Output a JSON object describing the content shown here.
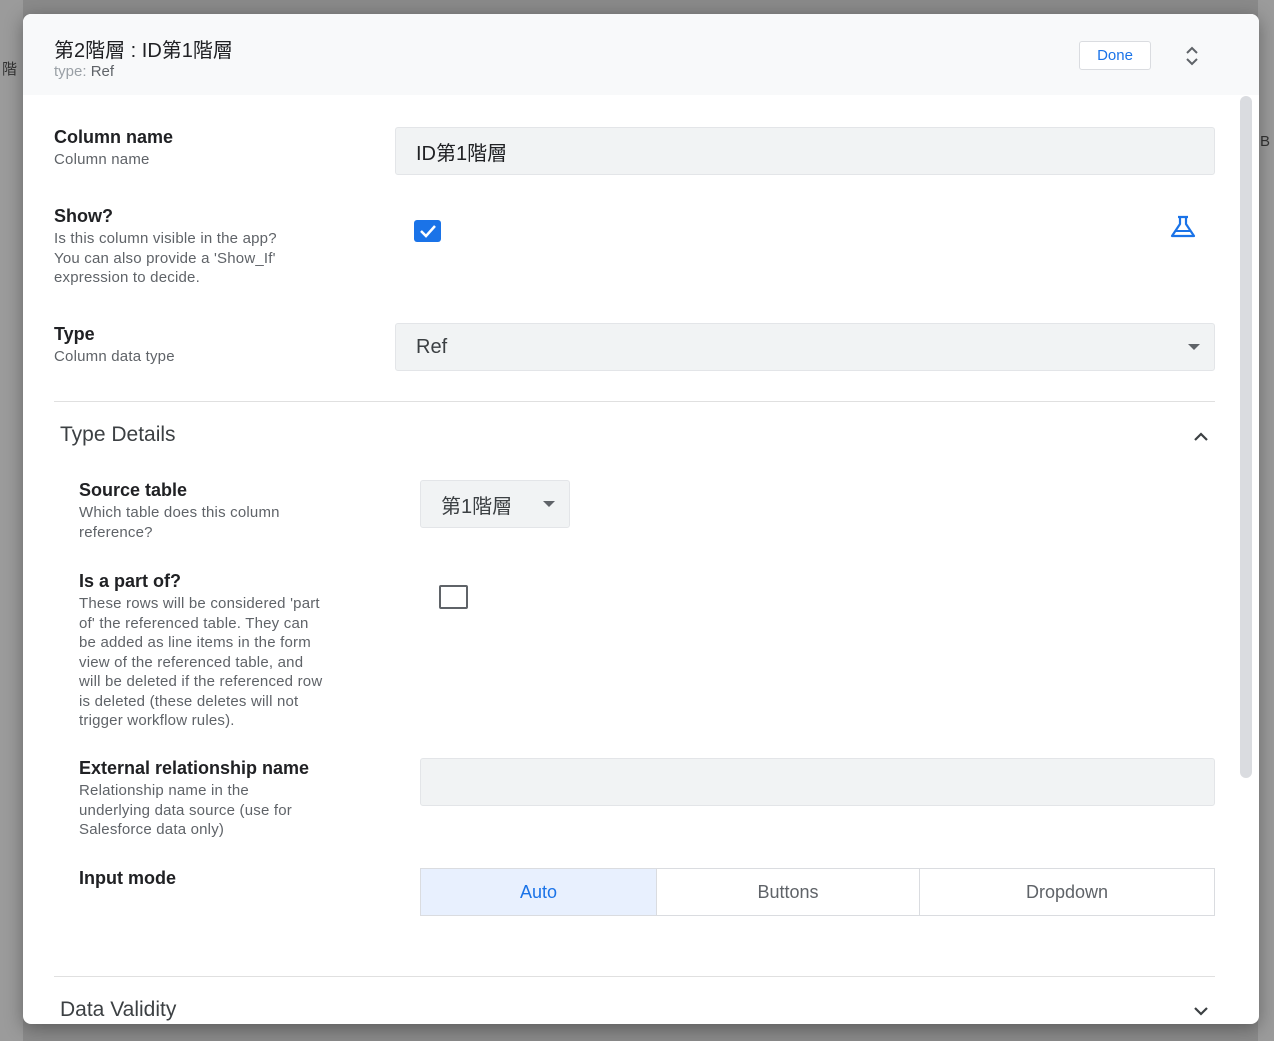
{
  "background": {
    "left_text": "階",
    "right_text": "B"
  },
  "header": {
    "title": "第2階層 : ID第1階層",
    "type_prefix": "type:",
    "type_value": "Ref",
    "done_label": "Done"
  },
  "fields": {
    "column_name": {
      "label": "Column name",
      "description": "Column name",
      "value": "ID第1階層"
    },
    "show": {
      "label": "Show?",
      "description_lines": [
        "Is this column visible in the app?",
        "You can also provide a 'Show_If'",
        "expression to decide."
      ],
      "checked": true
    },
    "type": {
      "label": "Type",
      "description": "Column data type",
      "value": "Ref"
    }
  },
  "type_details": {
    "title": "Type Details",
    "source_table": {
      "label": "Source table",
      "description_lines": [
        "Which table does this column",
        "reference?"
      ],
      "value": "第1階層"
    },
    "part_of": {
      "label": "Is a part of?",
      "description_lines": [
        "These rows will be considered 'part",
        "of' the referenced table. They can",
        "be added as line items in the form",
        "view of the referenced table, and",
        "will be deleted if the referenced row",
        "is deleted (these deletes will not",
        "trigger workflow rules)."
      ],
      "checked": false
    },
    "external_relationship": {
      "label": "External relationship name",
      "description_lines": [
        "Relationship name in the",
        "underlying data source (use for",
        "Salesforce data only)"
      ],
      "value": ""
    },
    "input_mode": {
      "label": "Input mode",
      "options": [
        "Auto",
        "Buttons",
        "Dropdown"
      ],
      "selected": "Auto"
    }
  },
  "data_validity": {
    "title": "Data Validity"
  },
  "colors": {
    "accent": "#1a73e8",
    "active_segment_bg": "#e8f0fe"
  },
  "icons": {
    "test_expression": "flask-icon",
    "collapse_dialog": "unfold-less-icon",
    "type_details_toggle": "chevron-up-icon",
    "data_validity_toggle": "chevron-down-icon"
  }
}
